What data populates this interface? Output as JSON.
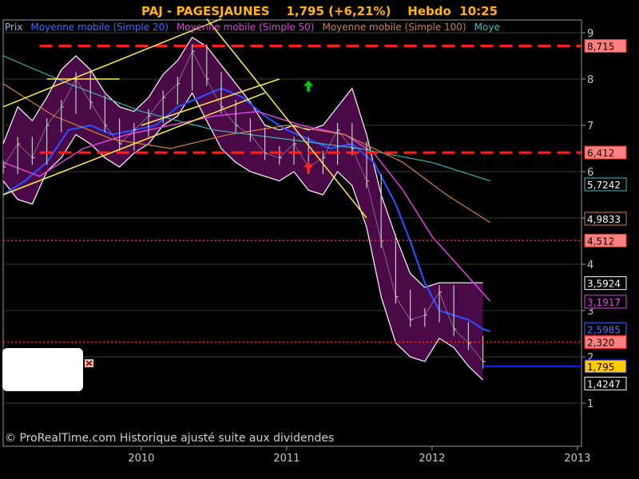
{
  "header": {
    "title": "PAJ - PAGESJAUNES    1,795 (+6,21%)    Hebdo  10:25"
  },
  "legend": [
    {
      "text": "Prix",
      "color": "#8fb3ff"
    },
    {
      "text": "Moyenne mobile (Simple 20)",
      "color": "#3b6bff"
    },
    {
      "text": "Moyenne mobile (Simple 50)",
      "color": "#e040e0"
    },
    {
      "text": "Moyenne mobile (Simple 100)",
      "color": "#d08040"
    },
    {
      "text": "Moye",
      "color": "#40c0c0"
    }
  ],
  "footer": {
    "copyright": "© ProRealTime.com Historique ajusté suite aux dividendes"
  },
  "chart_data": {
    "type": "line",
    "x_ticks": [
      "2010",
      "2011",
      "2012",
      "2013"
    ],
    "y_ticks": [
      "1",
      "2",
      "3",
      "4",
      "5",
      "6",
      "7",
      "8",
      "9"
    ],
    "ylim": [
      0.1,
      9.0
    ],
    "xlim": [
      2009.05,
      2013.3
    ],
    "grid": true,
    "colors": {
      "price": "#c8c8c8",
      "band_fill": "#4a0a48",
      "band_edge": "#ffffff",
      "ma20": "#2b4cff",
      "ma50": "#e040e0",
      "ma100": "#d08040",
      "ma200": "#40b0b0",
      "resistance": "#ff2020",
      "trendline": "#ffee44",
      "current": "#1020ff"
    },
    "series": [
      {
        "key": "price",
        "x": [
          2009.05,
          2009.15,
          2009.25,
          2009.35,
          2009.45,
          2009.55,
          2009.65,
          2009.75,
          2009.85,
          2009.95,
          2010.05,
          2010.15,
          2010.25,
          2010.35,
          2010.45,
          2010.55,
          2010.65,
          2010.75,
          2010.85,
          2010.95,
          2011.05,
          2011.15,
          2011.25,
          2011.35,
          2011.45,
          2011.55,
          2011.65,
          2011.75,
          2011.85,
          2011.95,
          2012.05,
          2012.15,
          2012.25,
          2012.35
        ],
        "values": [
          6.1,
          6.6,
          6.3,
          7.0,
          7.4,
          8.0,
          7.5,
          7.0,
          6.6,
          6.9,
          7.2,
          7.6,
          7.9,
          8.6,
          8.0,
          7.4,
          7.0,
          6.8,
          6.4,
          6.3,
          6.6,
          6.1,
          6.3,
          6.9,
          6.5,
          5.8,
          4.5,
          3.3,
          2.8,
          2.9,
          3.4,
          2.6,
          2.3,
          1.9
        ]
      },
      {
        "key": "ma20",
        "x": [
          2009.05,
          2009.2,
          2009.35,
          2009.5,
          2009.65,
          2009.8,
          2009.95,
          2010.1,
          2010.25,
          2010.4,
          2010.55,
          2010.7,
          2010.85,
          2011.0,
          2011.15,
          2011.3,
          2011.45,
          2011.6,
          2011.75,
          2011.85,
          2011.95,
          2012.05,
          2012.15,
          2012.25,
          2012.35,
          2012.4
        ],
        "values": [
          5.5,
          5.8,
          6.2,
          6.9,
          7.0,
          6.8,
          6.9,
          7.0,
          7.4,
          7.6,
          7.8,
          7.6,
          7.2,
          6.9,
          6.7,
          6.5,
          6.6,
          6.2,
          5.3,
          4.5,
          3.6,
          3.0,
          2.9,
          2.8,
          2.6,
          2.55
        ]
      },
      {
        "key": "ma50",
        "x": [
          2009.05,
          2009.3,
          2009.6,
          2009.9,
          2010.2,
          2010.5,
          2010.8,
          2011.1,
          2011.4,
          2011.6,
          2011.8,
          2012.0,
          2012.2,
          2012.4
        ],
        "values": [
          6.2,
          5.9,
          6.5,
          6.8,
          7.0,
          7.2,
          7.3,
          7.0,
          6.8,
          6.4,
          5.6,
          4.6,
          3.9,
          3.2
        ]
      },
      {
        "key": "ma100",
        "x": [
          2009.05,
          2009.4,
          2009.8,
          2010.2,
          2010.6,
          2011.0,
          2011.4,
          2011.8,
          2012.1,
          2012.4
        ],
        "values": [
          7.9,
          7.2,
          6.7,
          6.5,
          6.8,
          7.0,
          6.8,
          6.2,
          5.5,
          4.9
        ]
      },
      {
        "key": "ma200",
        "x": [
          2009.05,
          2009.5,
          2010.0,
          2010.5,
          2011.0,
          2011.5,
          2012.0,
          2012.4
        ],
        "values": [
          8.5,
          7.9,
          7.3,
          6.9,
          6.7,
          6.5,
          6.2,
          5.8
        ]
      }
    ],
    "bands": {
      "upper": [
        6.6,
        7.4,
        7.1,
        7.6,
        8.2,
        8.5,
        8.2,
        7.7,
        7.4,
        7.3,
        7.6,
        8.1,
        8.4,
        8.9,
        8.7,
        8.3,
        7.9,
        7.5,
        7.0,
        6.9,
        7.0,
        6.9,
        7.0,
        7.4,
        7.8,
        6.8,
        5.5,
        4.6,
        3.8,
        3.5,
        3.6,
        3.6,
        3.6,
        3.6
      ],
      "lower": [
        5.8,
        5.4,
        5.3,
        6.0,
        6.3,
        6.8,
        6.6,
        6.3,
        6.1,
        6.4,
        6.6,
        7.0,
        7.2,
        7.7,
        7.1,
        6.5,
        6.2,
        6.0,
        5.9,
        5.8,
        6.0,
        5.6,
        5.5,
        6.0,
        5.7,
        4.8,
        3.3,
        2.3,
        2.0,
        1.9,
        2.4,
        2.2,
        1.8,
        1.5
      ]
    },
    "levels": [
      {
        "label": "8,715",
        "value": 8.715,
        "style": "dash-thick",
        "color": "#ff2020",
        "bg": "#ff8080",
        "fg": "#000000"
      },
      {
        "label": "6,412",
        "value": 6.412,
        "style": "dash-thick",
        "color": "#ff2020",
        "bg": "#ff8080",
        "fg": "#000000"
      },
      {
        "label": "5,7242",
        "value": 5.7242,
        "style": "none",
        "color": "#40c0c0",
        "bg": "#000000",
        "fg": "#ffffff"
      },
      {
        "label": "4,9833",
        "value": 4.9833,
        "style": "none",
        "color": "#d08040",
        "bg": "#000000",
        "fg": "#ffffff"
      },
      {
        "label": "4,512",
        "value": 4.512,
        "style": "dot",
        "color": "#ff2020",
        "bg": "#ff8080",
        "fg": "#000000"
      },
      {
        "label": "3,5924",
        "value": 3.5924,
        "style": "none",
        "color": "#ffffff",
        "bg": "#000000",
        "fg": "#ffffff"
      },
      {
        "label": "3,1917",
        "value": 3.1917,
        "style": "none",
        "color": "#e040e0",
        "bg": "#000000",
        "fg": "#e040e0"
      },
      {
        "label": "2,5985",
        "value": 2.5985,
        "style": "none",
        "color": "#3b6bff",
        "bg": "#000000",
        "fg": "#6070ff"
      },
      {
        "label": "2,320",
        "value": 2.32,
        "style": "dot",
        "color": "#ff2020",
        "bg": "#ff8080",
        "fg": "#000000"
      },
      {
        "label": "1,795",
        "value": 1.795,
        "style": "solid",
        "color": "#1020ff",
        "bg": "#ffcc00",
        "fg": "#000000"
      },
      {
        "label": "1,4247",
        "value": 1.4247,
        "style": "none",
        "color": "#ffffff",
        "bg": "#000000",
        "fg": "#ffffff"
      }
    ],
    "trendlines": [
      {
        "x1": 2009.05,
        "y1": 7.4,
        "x2": 2010.55,
        "y2": 9.3
      },
      {
        "x1": 2009.05,
        "y1": 5.5,
        "x2": 2010.85,
        "y2": 7.7
      },
      {
        "x1": 2010.45,
        "y1": 9.3,
        "x2": 2011.55,
        "y2": 5.0
      },
      {
        "x1": 2010.0,
        "y1": 7.0,
        "x2": 2010.95,
        "y2": 8.0
      },
      {
        "x1": 2009.35,
        "y1": 8.0,
        "x2": 2009.85,
        "y2": 8.0
      }
    ],
    "markers": [
      {
        "type": "arrow-up",
        "x": 2011.15,
        "y": 7.85,
        "color": "#00d000"
      },
      {
        "type": "arrow-up",
        "x": 2011.15,
        "y": 6.1,
        "color": "#ff2020"
      }
    ]
  }
}
